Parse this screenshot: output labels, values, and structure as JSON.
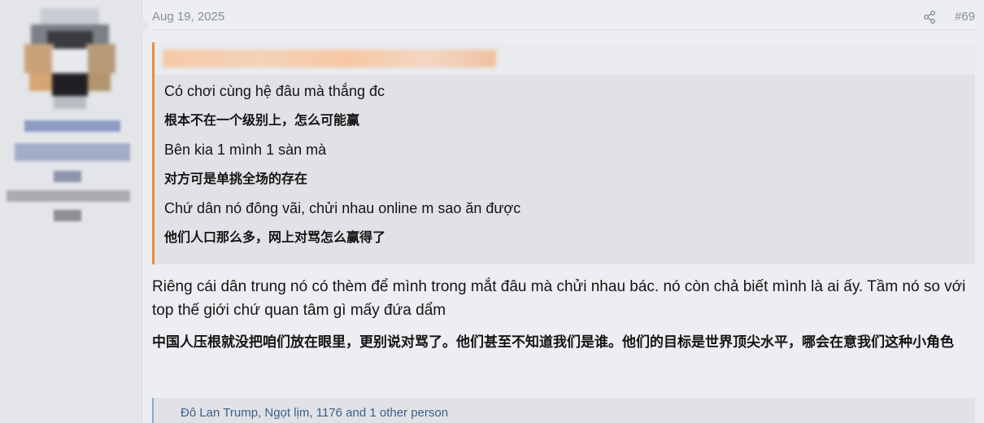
{
  "post": {
    "date": "Aug 19, 2025",
    "number": "#69",
    "share_icon": "share-icon"
  },
  "quote": {
    "lines": [
      "Có chơi cùng hệ đâu mà thắng đc",
      "根本不在一个级别上，怎么可能赢",
      "Bên kia 1 mình 1 sàn mà",
      "对方可是单挑全场的存在",
      "Chứ dân nó đông vãi, chửi nhau online m sao ăn được",
      "他们人口那么多，网上对骂怎么赢得了"
    ]
  },
  "body": {
    "vi": "Riêng cái dân trung nó có thèm để mình trong mắt đâu mà chửi nhau bác. nó còn chả biết mình là ai ấy. Tầm nó so với top thế giới chứ quan tâm gì mấy đứa dẩm",
    "cn": "中国人压根就没把咱们放在眼里，更别说对骂了。他们甚至不知道我们是谁。他们的目标是世界顶尖水平，哪会在意我们这种小角色"
  },
  "reactions": {
    "text": "Đô Lan Trump, Ngọt lịm, 1176 and 1 other person"
  },
  "colors": {
    "quote_accent": "#f08a3a",
    "reaction_link": "#3d5f8a",
    "muted": "#8a8f97"
  }
}
